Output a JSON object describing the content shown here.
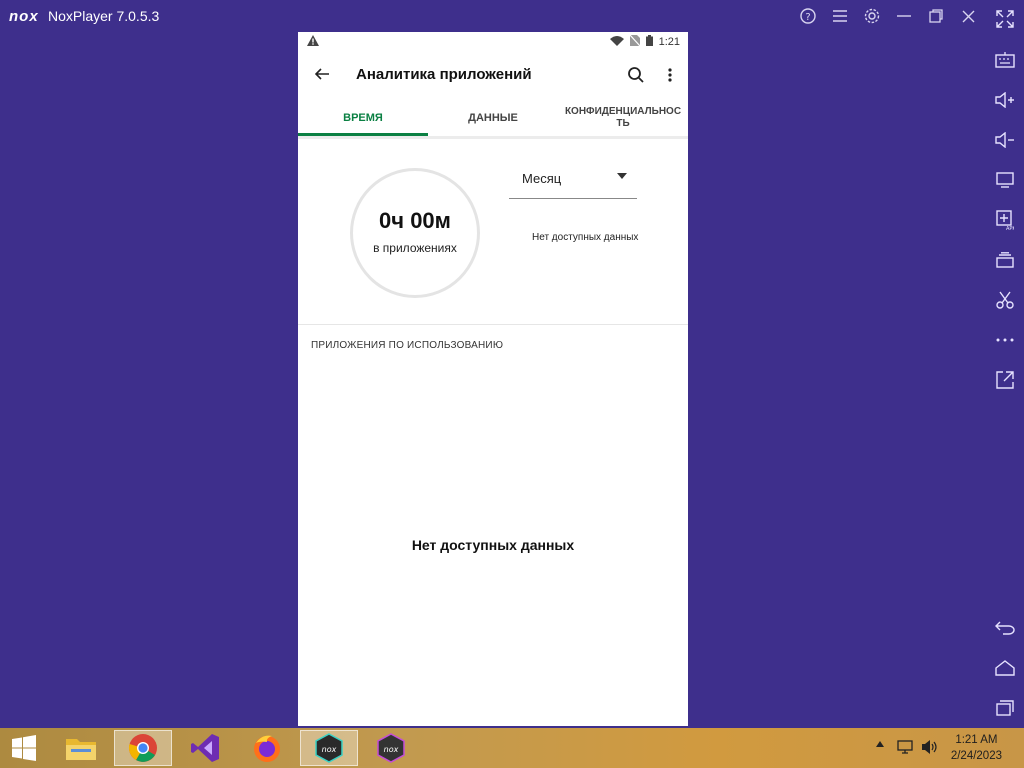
{
  "window": {
    "logo": "nox",
    "title": "NoxPlayer 7.0.5.3",
    "controls": [
      "help-icon",
      "menu-icon",
      "settings-icon",
      "minimize-icon",
      "restore-icon",
      "close-icon"
    ]
  },
  "sidebar": {
    "items": [
      "fullscreen-icon",
      "keyboard-icon",
      "volume-up-icon",
      "volume-down-icon",
      "screen-icon",
      "add-apk-icon",
      "multi-instance-icon",
      "screenshot-icon",
      "more-icon",
      "export-icon",
      "back-icon",
      "home-icon",
      "recents-icon"
    ]
  },
  "phone": {
    "status": {
      "time": "1:21"
    },
    "appbar": {
      "title": "Аналитика приложений"
    },
    "tabs": [
      {
        "label": "ВРЕМЯ",
        "active": true
      },
      {
        "label": "ДАННЫЕ",
        "active": false
      },
      {
        "label": "КОНФИДЕНЦИАЛЬНОС ТЬ",
        "active": false
      }
    ],
    "summary": {
      "hours": "0ч",
      "minutes": "00м",
      "sub": "в приложениях"
    },
    "period": {
      "selected": "Месяц"
    },
    "nodata_small": "Нет доступных данных",
    "section_title": "ПРИЛОЖЕНИЯ ПО ИСПОЛЬЗОВАНИЮ",
    "nodata_big": "Нет доступных данных"
  },
  "taskbar": {
    "apps": [
      "start-icon",
      "file-explorer-icon",
      "chrome-icon",
      "visual-studio-icon",
      "firefox-icon",
      "nox-icon",
      "nox-multi-icon"
    ],
    "clock_time": "1:21 AM",
    "clock_date": "2/24/2023"
  },
  "colors": {
    "background": "#3e2f8c",
    "accent": "#0b8043"
  }
}
